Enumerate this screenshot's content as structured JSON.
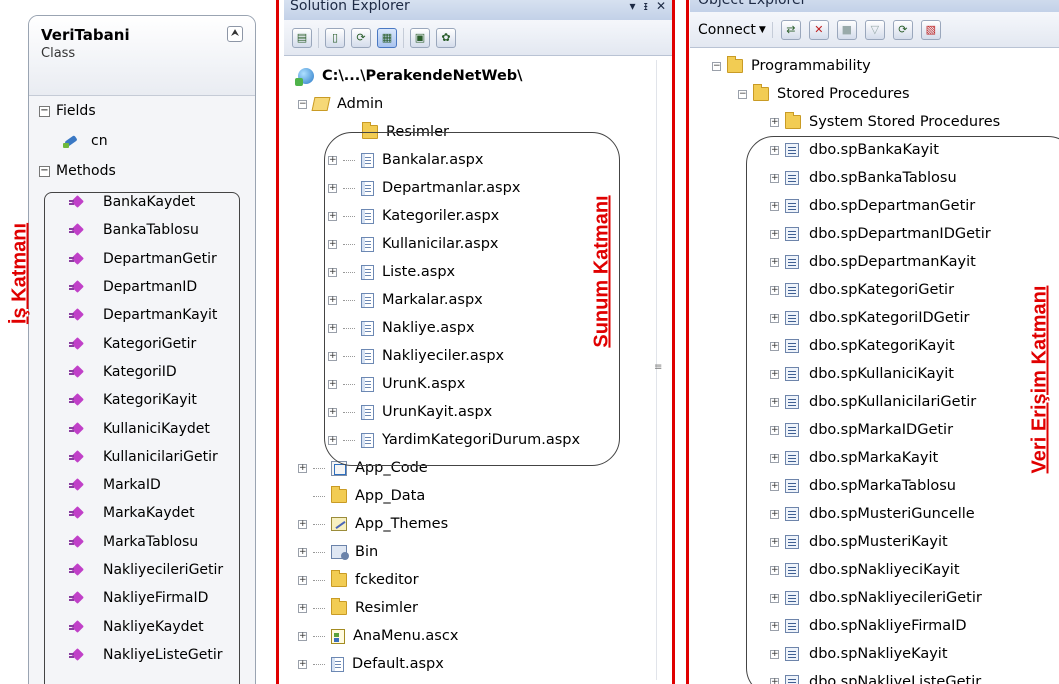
{
  "class_diagram": {
    "name": "VeriTabani",
    "kind": "Class",
    "collapse_glyph": "⮝",
    "fields_header": "Fields",
    "fields": [
      "cn"
    ],
    "methods_header": "Methods",
    "methods": [
      "BankaKaydet",
      "BankaTablosu",
      "DepartmanGetir",
      "DepartmanID",
      "DepartmanKayit",
      "KategoriGetir",
      "KategoriID",
      "KategoriKayit",
      "KullaniciKaydet",
      "KullanicilariGetir",
      "MarkaID",
      "MarkaKaydet",
      "MarkaTablosu",
      "NakliyecileriGetir",
      "NakliyeFirmaID",
      "NakliyeKaydet",
      "NakliyeListeGetir"
    ]
  },
  "layer_labels": {
    "business": "İş Katmanı",
    "presentation": "Sunum Katmanı",
    "data_access": "Veri Erişim Katmanı"
  },
  "solution_explorer": {
    "title": "Solution Explorer",
    "title_buttons": [
      "▾",
      "ᵻ",
      "✕"
    ],
    "root": "C:\\...\\PerakendeNetWeb\\",
    "admin_folder": "Admin",
    "admin_items": [
      "Resimler",
      "Bankalar.aspx",
      "Departmanlar.aspx",
      "Kategoriler.aspx",
      "Kullanicilar.aspx",
      "Liste.aspx",
      "Markalar.aspx",
      "Nakliye.aspx",
      "Nakliyeciler.aspx",
      "UrunK.aspx",
      "UrunKayit.aspx",
      "YardimKategoriDurum.aspx"
    ],
    "root_items": [
      "App_Code",
      "App_Data",
      "App_Themes",
      "Bin",
      "fckeditor",
      "Resimler",
      "AnaMenu.ascx",
      "Default.aspx"
    ]
  },
  "object_explorer": {
    "title": "Object Explorer",
    "connect_label": "Connect",
    "programmability": "Programmability",
    "stored_procedures": "Stored Procedures",
    "system_sp": "System Stored Procedures",
    "procedures": [
      "dbo.spBankaKayit",
      "dbo.spBankaTablosu",
      "dbo.spDepartmanGetir",
      "dbo.spDepartmanIDGetir",
      "dbo.spDepartmanKayit",
      "dbo.spKategoriGetir",
      "dbo.spKategoriIDGetir",
      "dbo.spKategoriKayit",
      "dbo.spKullaniciKayit",
      "dbo.spKullanicilariGetir",
      "dbo.spMarkaIDGetir",
      "dbo.spMarkaKayit",
      "dbo.spMarkaTablosu",
      "dbo.spMusteriGuncelle",
      "dbo.spMusteriKayit",
      "dbo.spNakliyeciKayit",
      "dbo.spNakliyecileriGetir",
      "dbo.spNakliyeFirmaID",
      "dbo.spNakliyeKayit",
      "dbo.spNakliyeListeGetir"
    ]
  },
  "colors": {
    "accent_red": "#e00000",
    "panel_header": "#c3d1e8"
  }
}
